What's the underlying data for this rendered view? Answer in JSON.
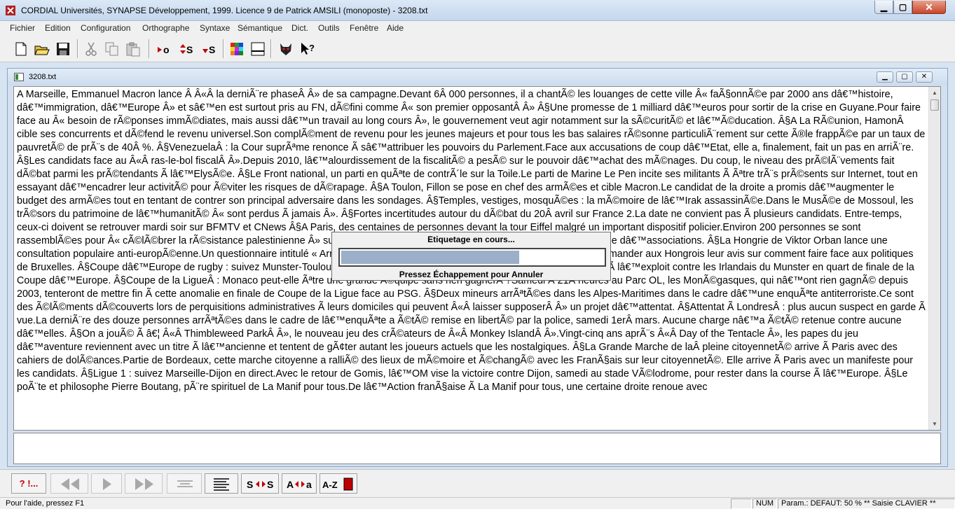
{
  "window": {
    "title": "CORDIAL Universités, SYNAPSE Développement, 1999. Licence 9 de Patrick AMSILI (monoposte) - 3208.txt",
    "minimize_glyph": "▁",
    "maximize_glyph": "▢",
    "close_glyph": "✕"
  },
  "menu": {
    "items": [
      "Fichier",
      "Edition",
      "Configuration",
      "Orthographe",
      "Syntaxe",
      "Sémantique",
      "Dict.",
      "Outils",
      "Fenêtre",
      "Aide"
    ]
  },
  "toolbar": {
    "icons": [
      "new-file-icon",
      "open-folder-icon",
      "save-disk-icon",
      "cut-scissors-icon",
      "copy-icon",
      "paste-icon",
      "spelling-icon",
      "syntax-icon",
      "grammar-icon",
      "color-palette-icon",
      "view-pane-icon",
      "devil-mask-icon",
      "help-cursor-icon"
    ],
    "labels": {
      "spell": "o",
      "syntax": "S",
      "grammar": "S"
    }
  },
  "document": {
    "title": "3208.txt",
    "text": "A Marseille, Emmanuel Macron lance Â Â«Â la derniÃ¨re phaseÂ Â» de sa campagne.Devant 6Â 000 personnes, il a chantÃ© les louanges de cette ville Â« faÃ§onnÃ©e par 2000 ans dâ€™histoire, dâ€™immigration, dâ€™Europe Â» et sâ€™en est surtout pris au FN, dÃ©fini comme Â« son premier opposantÂ Â» Â§Une promesse de 1 milliard dâ€™euros pour sortir de la crise en Guyane.Pour faire face au Â« besoin de rÃ©ponses immÃ©diates, mais aussi dâ€™un travail au long cours Â», le gouvernement veut agir notamment sur la sÃ©curitÃ© et lâ€™Ã©ducation. Â§A La RÃ©union, HamonÂ cible ses concurrents et dÃ©fend le revenu universel.Son complÃ©ment de revenu pour les jeunes majeurs et pour tous les bas salaires rÃ©sonne particuliÃ¨rement sur cette Ã®le frappÃ©e par un taux de pauvretÃ© de prÃ¨s de 40Â %. Â§VenezuelaÂ : la Cour suprÃªme renonce Ã  sâ€™attribuer les pouvoirs du Parlement.Face aux accusations de coup dâ€™Etat, elle a, finalement, fait un pas en arriÃ¨re. Â§Les candidats face au Â«Â ras-le-bol fiscalÂ Â».Depuis 2010, lâ€™alourdissement de la fiscalitÃ© a pesÃ© sur le pouvoir dâ€™achat des mÃ©nages. Du coup, le niveau des prÃ©lÃ¨vements fait dÃ©bat parmi les prÃ©tendants Ã  lâ€™ElysÃ©e. Â§Le Front national, un parti en quÃªte de contrÃ´le sur la Toile.Le parti de Marine Le Pen incite ses militants Ã  Ãªtre trÃ¨s prÃ©sents sur Internet, tout en essayant dâ€™encadrer leur activitÃ© pour Ã©viter les risques de dÃ©rapage. Â§A Toulon, Fillon se pose en chef des armÃ©es et cible Macron.Le candidat de la droite a promis dâ€™augmenter le budget des armÃ©es tout en tentant de contrer son principal adversaire dans les sondages. Â§Temples, vestiges, mosquÃ©es : la mÃ©moire de lâ€™Irak assassinÃ©e.Dans le MusÃ©e de Mossoul, les trÃ©sors du patrimoine de lâ€™humanitÃ© Â« sont perdus Ã  jamais Â». Â§Fortes incertitudes autour du dÃ©bat du 20Â avril sur France 2.La date ne convient pas Ã  plusieurs candidats. Entre-temps, ceux-ci doivent se retrouver mardi soir sur BFMTV et CNews Â§A Paris, des centaines de personnes devant la tour Eiffel malgré un important dispositif policier.Environ 200 personnes se sont rassemblÃ©es pour Â« cÃ©lÃ©brer la rÃ©sistance palestinienne Â» sur la place de la République, Ã  lâ€™appel dâ€™une quarantaine dâ€™associations. Â§La Hongrie de Viktor Orban lance une consultation populaire anti-europÃ©enne.Un questionnaire intitulé « Arrêtons Bruxelles Â» a Ã©tÃ© envoyÃ© Ã  chaque foyer pour demander aux Hongrois leur avis sur comment faire face aux politiques de Bruxelles. Â§Coupe dâ€™Europe de rugby : suivez Munster-Toulouse en direct.En difficultÃ© en Top 14, le Stade toulousain croit Ã  lâ€™exploit contre les Irlandais du Munster en quart de finale de la Coupe dâ€™Europe. Â§Coupe de la LigueÂ : Monaco peut-elle Ãªtre une grande Ã©quipe sans rien gagnerÂ ?Samedi Ã  21Â heures au Parc OL, les MonÃ©gasques, qui nâ€™ont rien gagnÃ© depuis 2003, tenteront de mettre fin Ã  cette anomalie en finale de Coupe de la Ligue face au PSG. Â§Deux mineurs arrÃªtÃ©es dans les Alpes-Maritimes dans le cadre dâ€™une enquÃªte antiterroriste.Ce sont des Ã©lÃ©ments dÃ©couverts lors de perquisitions administratives Ã  leurs domiciles qui peuvent Â«Â laisser supposerÂ Â» un projet dâ€™attentat. Â§Attentat Ã  LondresÂ : plus aucun suspect en garde Ã  vue.La derniÃ¨re des douze personnes arrÃªtÃ©es dans le cadre de lâ€™enquÃªte a Ã©tÃ© remise en libertÃ© par la police, samedi 1erÂ mars. Aucune charge nâ€™a Ã©tÃ© retenue contre aucune dâ€™elles. Â§On a jouÃ© Ã â€¦ Â«Â Thimbleweed ParkÂ Â», le nouveau jeu des crÃ©ateurs de Â«Â Monkey IslandÂ Â».Vingt-cinq ans aprÃ¨s Â«Â Day of the Tentacle Â», les papes du jeu dâ€™aventure reviennent avec un titre Ã  lâ€™ancienne et tentent de gÃ¢ter autant les joueurs actuels que les nostalgiques. Â§La Grande Marche de laÂ pleine citoyennetÃ© arrive Ã  Paris avec des cahiers de dolÃ©ances.Partie de Bordeaux, cette marche citoyenne a ralliÃ© des lieux de mÃ©moire et Ã©changÃ© avec les FranÃ§ais sur leur citoyennetÃ©. Elle arrive Ã  Paris avec un manifeste pour les candidats. Â§Ligue 1 : suivez Marseille-Dijon en direct.Avec le retour de Gomis, lâ€™OM vise la victoire contre Dijon, samedi au stade VÃ©lodrome, pour rester dans la course Ã  lâ€™Europe. Â§Le poÃ¨te et philosophe Pierre Boutang, pÃ¨re spirituel de La Manif pour tous.De lâ€™Action franÃ§aise Ã  La Manif pour tous, une certaine droite renoue avec"
  },
  "progress": {
    "title": "Etiquetage en cours...",
    "fraction": 0.68,
    "hint": "Pressez Échappement pour Annuler"
  },
  "bottom_toolbar": {
    "error_label": "? !...",
    "swap_label": "S",
    "swap_label2": "S",
    "case_a1": "A",
    "case_a2": "a",
    "sort_label": "A-Z"
  },
  "status": {
    "help": "Pour l'aide, pressez F1",
    "num": "NUM",
    "params": "Param.: DEFAUT: 50 % ** Saisie CLAVIER **"
  }
}
